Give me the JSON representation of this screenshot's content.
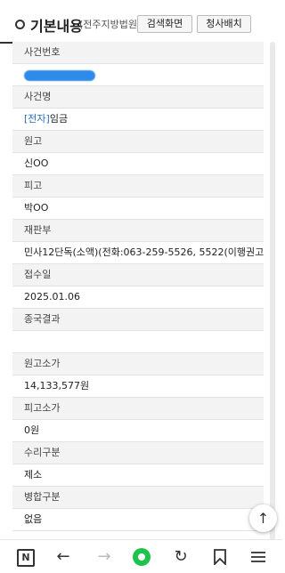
{
  "header": {
    "title": "기본내용",
    "subtitle": "(전주지방법원)",
    "search_button": "검색화면",
    "assign_button": "청사배치"
  },
  "rows": [
    {
      "label": "사건번호",
      "value": "",
      "redacted": true
    },
    {
      "label": "사건명",
      "value_prefix": "[전자]",
      "value": "임금"
    },
    {
      "label": "원고",
      "value": "신OO"
    },
    {
      "label": "피고",
      "value": "박OO"
    },
    {
      "label": "재판부",
      "value": "민사12단독(소액)(전화:063-259-5526, 5522(이행권고))"
    },
    {
      "label": "접수일",
      "value": "2025.01.06"
    },
    {
      "label": "종국결과",
      "value": ""
    },
    {
      "label": "원고소가",
      "value": "14,133,577원"
    },
    {
      "label": "피고소가",
      "value": "0원"
    },
    {
      "label": "수리구분",
      "value": "제소"
    },
    {
      "label": "병합구분",
      "value": "없음"
    }
  ],
  "nav": {
    "home_color": "#1ec34b",
    "icons": [
      "naver-n-icon",
      "back-arrow-icon",
      "forward-arrow-icon",
      "home-dot-icon",
      "reload-icon",
      "bookmark-icon",
      "menu-icon"
    ]
  },
  "scroll_top_icon": "arrow-up-icon"
}
